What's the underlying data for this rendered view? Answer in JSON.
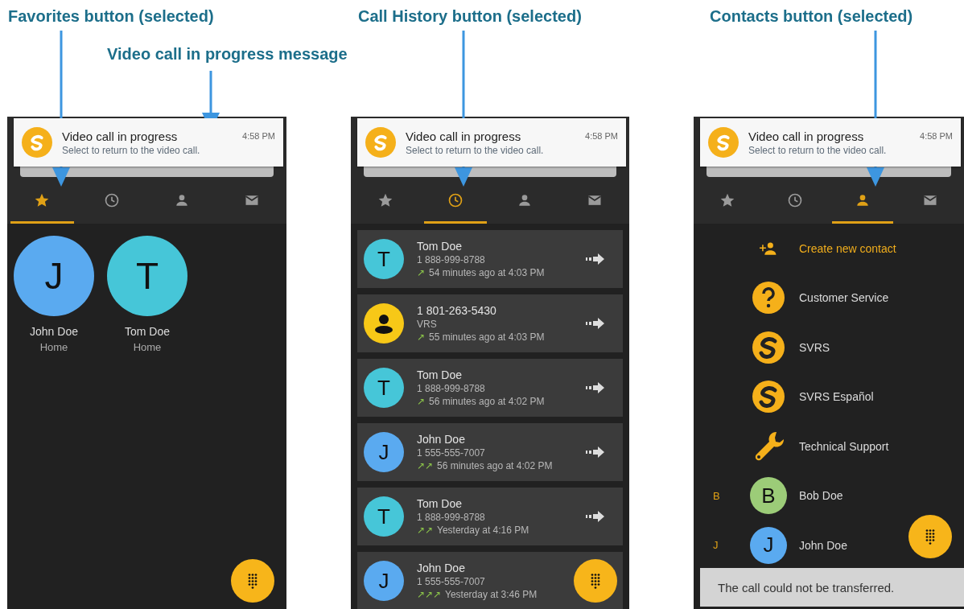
{
  "callouts": [
    {
      "text": "Favorites button (selected)"
    },
    {
      "text": "Call History button (selected)"
    },
    {
      "text": "Contacts button (selected)"
    },
    {
      "text": "Video call in progress message"
    }
  ],
  "phones": [
    {
      "notification": {
        "title": "Video call in progress",
        "subtitle": "Select to return to the video call.",
        "time": "4:58 PM"
      },
      "tabs": [
        {
          "kind": "star",
          "selected": true
        },
        {
          "kind": "clock",
          "selected": false
        },
        {
          "kind": "person",
          "selected": false
        },
        {
          "kind": "mail",
          "selected": false
        }
      ],
      "kind": "favorites",
      "favorites": [
        {
          "initial": "J",
          "name": "John Doe",
          "label": "Home",
          "color": "#5aaaf0"
        },
        {
          "initial": "T",
          "name": "Tom Doe",
          "label": "Home",
          "color": "#46c6d8"
        }
      ]
    },
    {
      "notification": {
        "title": "Video call in progress",
        "subtitle": "Select to return to the video call.",
        "time": "4:58 PM"
      },
      "tabs": [
        {
          "kind": "star",
          "selected": false
        },
        {
          "kind": "clock",
          "selected": true
        },
        {
          "kind": "person",
          "selected": false
        },
        {
          "kind": "mail",
          "selected": false
        }
      ],
      "kind": "history",
      "calls": [
        {
          "kind": "letter",
          "initial": "T",
          "color": "#46c6d8",
          "name": "Tom Doe",
          "detail": "1 888-999-8788",
          "marks": "↗",
          "time": "54 minutes ago at 4:03 PM"
        },
        {
          "kind": "person",
          "color": "#f7c817",
          "name": "1 801-263-5430",
          "detail": "VRS",
          "marks": "↗",
          "time": "55 minutes ago at 4:03 PM"
        },
        {
          "kind": "letter",
          "initial": "T",
          "color": "#46c6d8",
          "name": "Tom Doe",
          "detail": "1 888-999-8788",
          "marks": "↗",
          "time": "56 minutes ago at 4:02 PM"
        },
        {
          "kind": "letter",
          "initial": "J",
          "color": "#5aaaf0",
          "name": "John Doe",
          "detail": "1 555-555-7007",
          "marks": "↗↗",
          "time": "56 minutes ago at 4:02 PM"
        },
        {
          "kind": "letter",
          "initial": "T",
          "color": "#46c6d8",
          "name": "Tom Doe",
          "detail": "1 888-999-8788",
          "marks": "↗↗",
          "time": "Yesterday at 4:16 PM"
        },
        {
          "kind": "letter",
          "initial": "J",
          "color": "#5aaaf0",
          "name": "John Doe",
          "detail": "1 555-555-7007",
          "marks": "↗↗↗",
          "time": "Yesterday at 3:46 PM",
          "forward": false
        }
      ]
    },
    {
      "notification": {
        "title": "Video call in progress",
        "subtitle": "Select to return to the video call.",
        "time": "4:58 PM"
      },
      "tabs": [
        {
          "kind": "star",
          "selected": false
        },
        {
          "kind": "clock",
          "selected": false
        },
        {
          "kind": "person",
          "selected": true
        },
        {
          "kind": "mail",
          "selected": false
        }
      ],
      "kind": "contacts",
      "contacts": [
        {
          "kind": "create",
          "name": "Create new contact"
        },
        {
          "kind": "help",
          "name": "Customer Service"
        },
        {
          "kind": "logo",
          "name": "SVRS"
        },
        {
          "kind": "logo",
          "name": "SVRS Español"
        },
        {
          "kind": "wrench",
          "name": "Technical Support"
        },
        {
          "kind": "letter",
          "section": "B",
          "initial": "B",
          "color": "#9ccc78",
          "name": "Bob Doe"
        },
        {
          "kind": "letter",
          "section": "J",
          "initial": "J",
          "color": "#5aaaf0",
          "name": "John Doe"
        }
      ],
      "toast": "The call could not be transferred."
    }
  ]
}
